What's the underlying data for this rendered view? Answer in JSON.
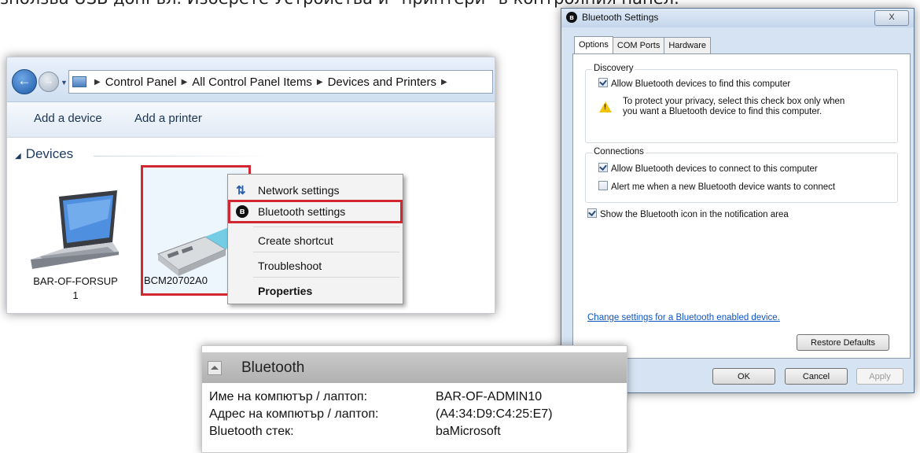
{
  "caption": {
    "text": "зползва USB донгъл. Изберете Устройства и \"принтери\" в контролния панел."
  },
  "explorer": {
    "breadcrumbs": [
      "Control Panel",
      "All Control Panel Items",
      "Devices and Printers"
    ],
    "toolbar": {
      "add_device": "Add a device",
      "add_printer": "Add a printer"
    },
    "group_header": "Devices",
    "devices": [
      {
        "name_line1": "BAR-OF-FORSUP",
        "name_line2": "1"
      },
      {
        "name_line1": "BCM20702A0",
        "name_line2": ""
      }
    ],
    "context_menu": {
      "items": [
        "Network settings",
        "Bluetooth settings",
        "Create shortcut",
        "Troubleshoot",
        "Properties"
      ]
    }
  },
  "dialog": {
    "title": "Bluetooth Settings",
    "close_label": "X",
    "tabs": [
      "Options",
      "COM Ports",
      "Hardware"
    ],
    "discovery": {
      "title": "Discovery",
      "allow_find": "Allow Bluetooth devices to find this computer",
      "warning_line1": "To protect your privacy, select this check box only when",
      "warning_line2": "you want a Bluetooth device to find this computer."
    },
    "connections": {
      "title": "Connections",
      "allow_connect": "Allow Bluetooth devices to connect to this computer",
      "alert_new": "Alert me when a new Bluetooth device wants to connect"
    },
    "show_icon": "Show the Bluetooth icon in the notification area",
    "link": "Change settings for a Bluetooth enabled device.",
    "buttons": {
      "restore": "Restore Defaults",
      "ok": "OK",
      "cancel": "Cancel",
      "apply": "Apply"
    },
    "checked": {
      "allow_find": true,
      "allow_connect": true,
      "alert_new": false,
      "show_icon": true
    }
  },
  "info_panel": {
    "title": "Bluetooth",
    "rows": [
      {
        "label": "Име на компютър / лаптоп:",
        "value": "BAR-OF-ADMIN10"
      },
      {
        "label": "Адрес на компютър / лаптоп:",
        "value": "(A4:34:D9:C4:25:E7)"
      },
      {
        "label": "Bluetooth стек:",
        "value": "baMicrosoft"
      }
    ]
  },
  "colors": {
    "highlight_red": "#d22630",
    "link_blue": "#0b55c4",
    "warning_yellow": "#f1c50f"
  }
}
